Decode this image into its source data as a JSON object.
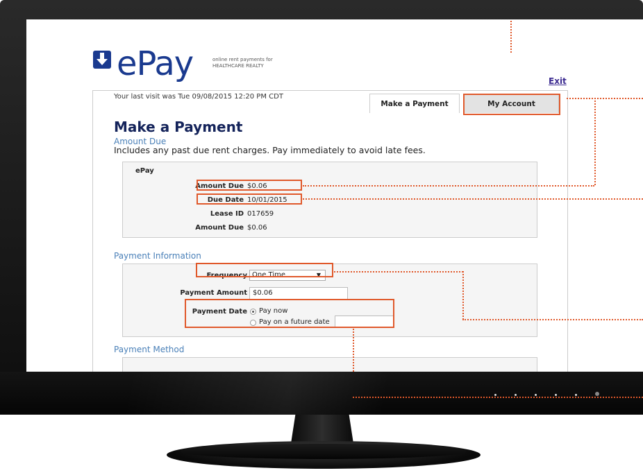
{
  "brand": {
    "logo_word": "ePay",
    "tagline_line1": "online rent payments for",
    "tagline_line2": "HEALTHCARE REALTY"
  },
  "header": {
    "exit_label": "Exit",
    "last_visit": "Your last visit was Tue 09/08/2015 12:20 PM CDT"
  },
  "tabs": [
    {
      "label": "Make a Payment",
      "active": true
    },
    {
      "label": "My Account",
      "active": false
    }
  ],
  "page_title": "Make a Payment",
  "amount_due_section": {
    "heading": "Amount Due",
    "note": "Includes any past due rent charges. Pay immediately to avoid late fees.",
    "group_title": "ePay",
    "rows": [
      {
        "label": "Amount Due",
        "value": "$0.06"
      },
      {
        "label": "Due Date",
        "value": "10/01/2015"
      },
      {
        "label": "Lease ID",
        "value": "017659"
      },
      {
        "label": "Amount Due",
        "value": "$0.06"
      }
    ]
  },
  "payment_info": {
    "heading": "Payment Information",
    "frequency_label": "Frequency",
    "frequency_value": "One Time",
    "amount_label": "Payment Amount",
    "amount_value": "$0.06",
    "date_label": "Payment Date",
    "option_now": "Pay now",
    "option_future": "Pay on a future date"
  },
  "payment_method": {
    "heading": "Payment Method"
  },
  "colors": {
    "brand": "#1a3a8f",
    "highlight": "#e0582a",
    "section_heading": "#4a80b8"
  }
}
